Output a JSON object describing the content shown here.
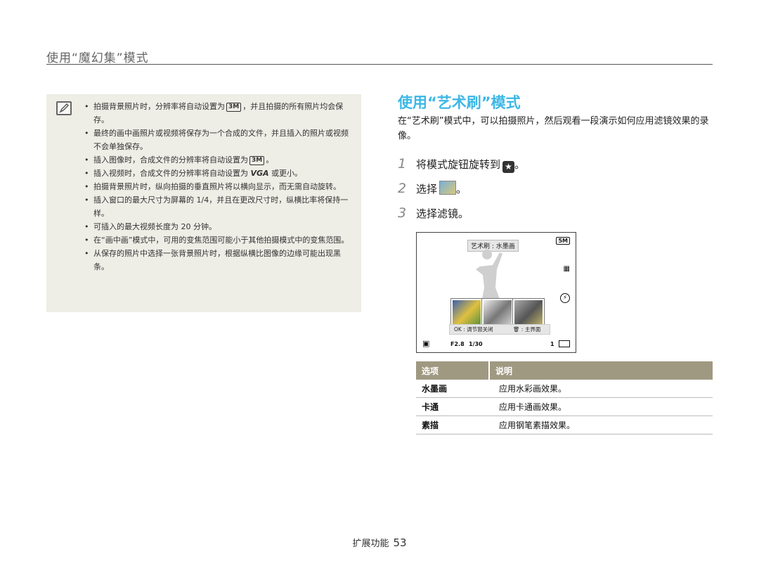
{
  "section_header": "使用“魔幻集”模式",
  "note": {
    "icon": "note-pencil-icon",
    "items": [
      {
        "pre": "拍摄背景照片时，分辨率将自动设置为",
        "icon": "3M",
        "post": "，并且拍摄的所有照片均会保存。"
      },
      {
        "pre": "最终的画中画照片或视频将保存为一个合成的文件，并且插入的照片或视频不会单独保存。",
        "icon": "",
        "post": ""
      },
      {
        "pre": "插入图像时，合成文件的分辨率将自动设置为",
        "icon": "3M",
        "post": "。"
      },
      {
        "pre": "插入视频时，合成文件的分辨率将自动设置为",
        "vga": "VGA",
        "post": "或更小。"
      },
      {
        "pre": "拍摄背景照片时，纵向拍摄的垂直照片将以横向显示，而无需自动旋转。",
        "icon": "",
        "post": ""
      },
      {
        "pre": "插入窗口的最大尺寸为屏幕的 1/4，并且在更改尺寸时，纵横比率将保持一样。",
        "icon": "",
        "post": ""
      },
      {
        "pre": "可插入的最大视频长度为 20 分钟。",
        "icon": "",
        "post": ""
      },
      {
        "pre": "在“画中画”模式中，可用的变焦范围可能小于其他拍摄模式中的变焦范围。",
        "icon": "",
        "post": ""
      },
      {
        "pre": "从保存的照片中选择一张背景照片时，根据纵横比图像的边缘可能出现黑条。",
        "icon": "",
        "post": ""
      }
    ]
  },
  "main": {
    "title": "使用“艺术刷”模式",
    "intro": "在“艺术刷”模式中，可以拍摄照片，然后观看一段演示如何应用滤镜效果的录像。",
    "steps": [
      {
        "num": "1",
        "pre": "将模式旋钮旋转到",
        "icon": "★",
        "post": "。"
      },
      {
        "num": "2",
        "pre": "选择",
        "icon": "art-brush-icon",
        "post": "。"
      },
      {
        "num": "3",
        "pre": "选择滤镜。",
        "icon": "",
        "post": ""
      }
    ]
  },
  "camera_screen": {
    "label": "艺术刷 : 水墨画",
    "help_left": "OK : 调节窗关闭",
    "help_right": "🗑 : 主界面",
    "aperture": "F2.8",
    "shutter": "1/30",
    "shots": "1",
    "resolution_icon": "5M",
    "flash_icon": "⚡"
  },
  "table": {
    "headers": [
      "选项",
      "说明"
    ],
    "rows": [
      {
        "option": "水墨画",
        "desc": "应用水彩画效果。"
      },
      {
        "option": "卡通",
        "desc": "应用卡通画效果。"
      },
      {
        "option": "素描",
        "desc": "应用钢笔素描效果。"
      }
    ]
  },
  "footer": {
    "section": "扩展功能",
    "page": "53"
  },
  "colors": {
    "title_blue": "#3cb7e6",
    "table_header": "#a09982",
    "note_bg": "#eeede6"
  }
}
